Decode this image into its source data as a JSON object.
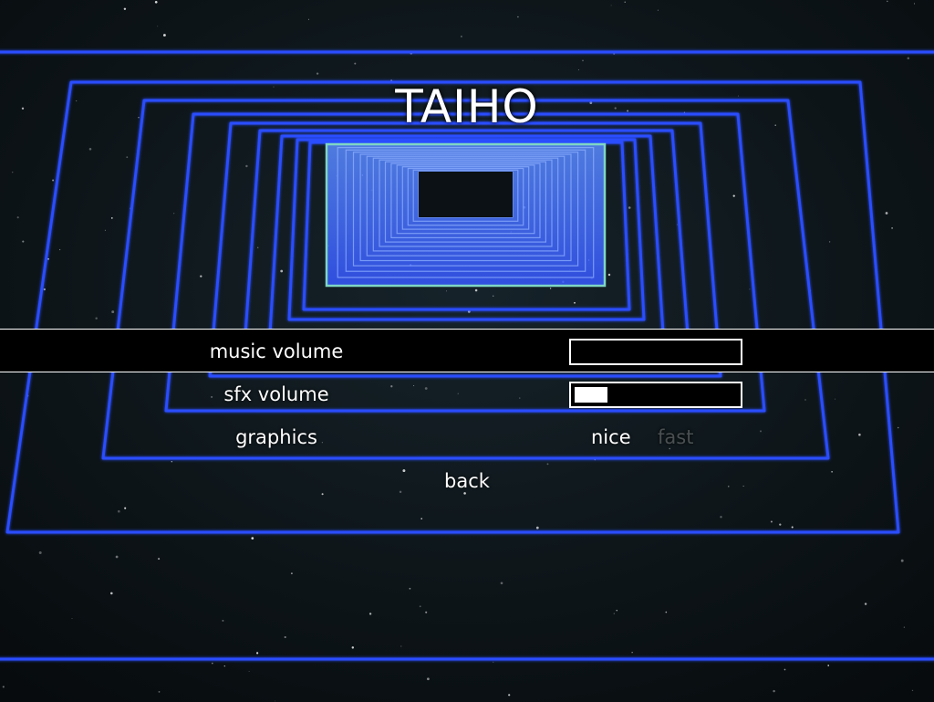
{
  "game": {
    "title": "TAIHO"
  },
  "menu": {
    "music_volume": {
      "label": "music volume",
      "level": 0.0,
      "selected": true
    },
    "sfx_volume": {
      "label": "sfx volume",
      "level": 0.2,
      "selected": false
    },
    "graphics": {
      "label": "graphics",
      "options": [
        "nice",
        "fast"
      ],
      "selected_option": "nice"
    },
    "back": {
      "label": "back"
    }
  },
  "colors": {
    "frame_blue": "#2a4dff",
    "tunnel_glow": "#4f7dff",
    "highlight_frame": "#7fd6c4",
    "selection_bar": "#000000",
    "text": "#ffffff",
    "inactive_text": "#4a5052"
  }
}
